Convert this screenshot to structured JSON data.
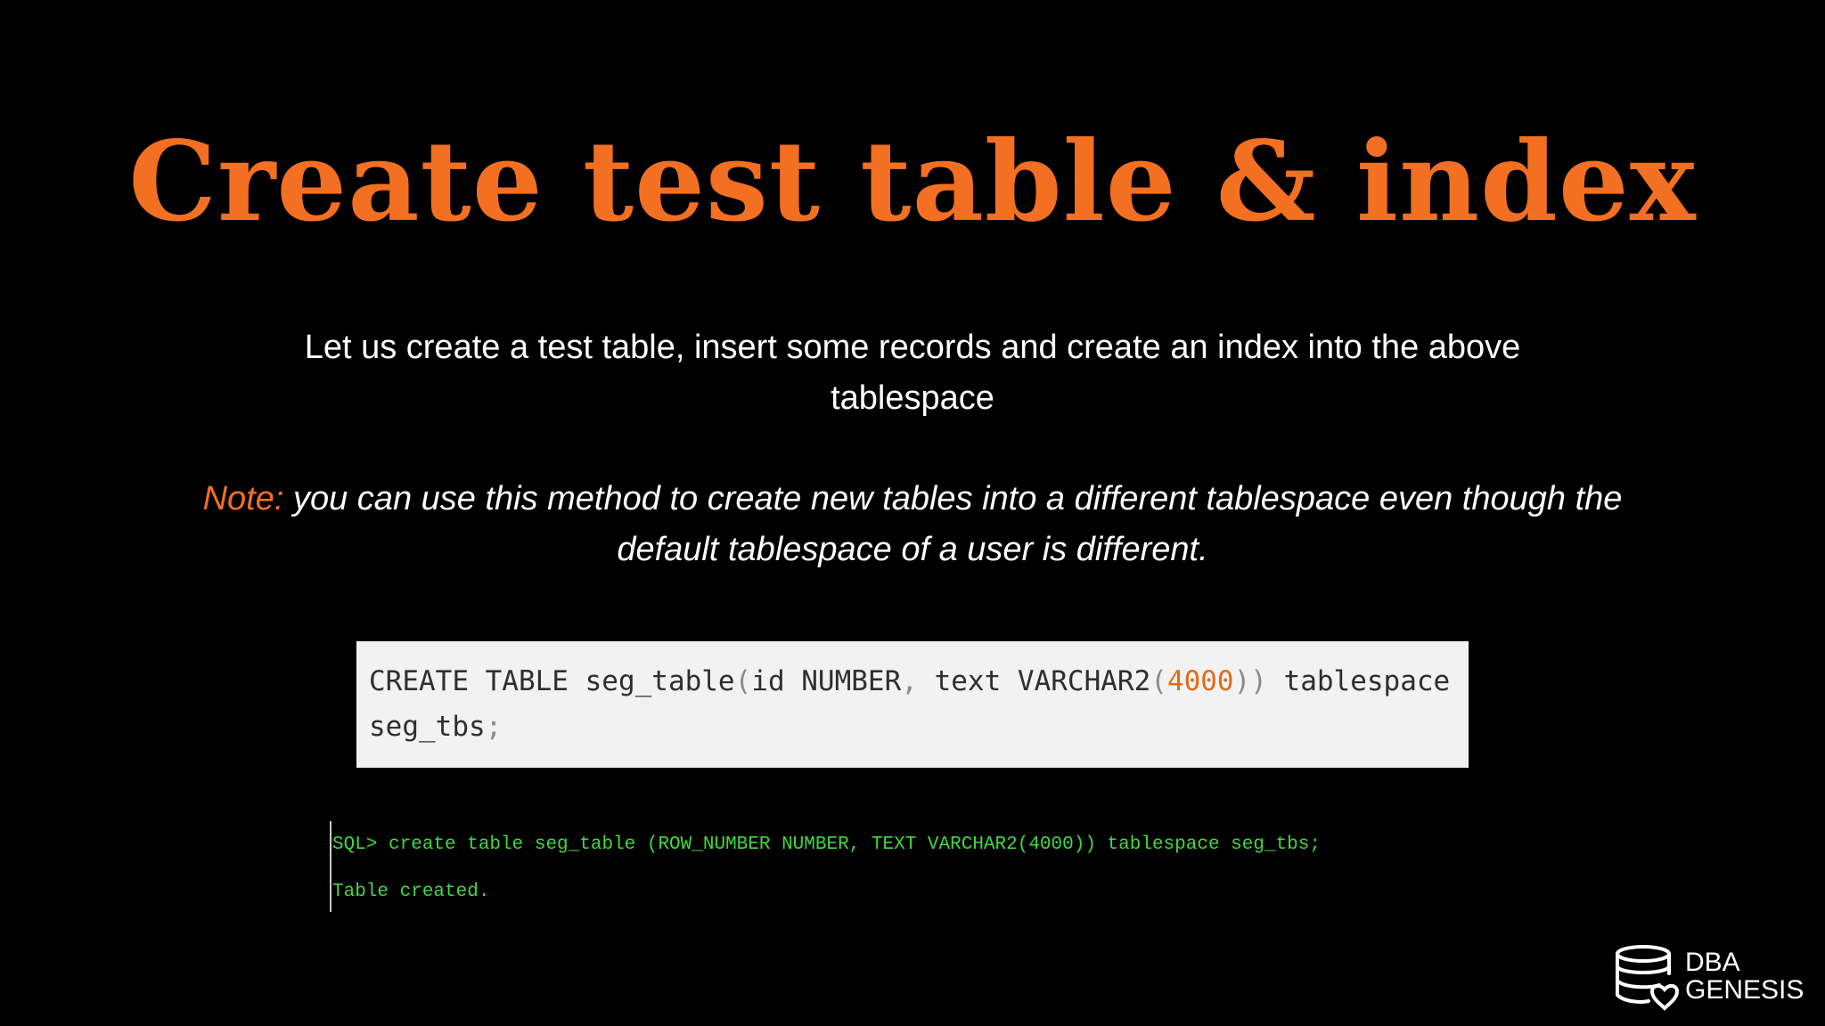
{
  "slide": {
    "title": "Create test table & index",
    "intro": "Let us create a test table, insert some records and create an index into the above tablespace",
    "note_label": "Note:",
    "note_text": " you can use this method to create new tables into a different tablespace even though the default tablespace of a user is different."
  },
  "code_snippet": {
    "part1": "CREATE TABLE seg_table",
    "paren_open": "(",
    "part2": "id NUMBER",
    "comma": ",",
    "part3": " text VARCHAR2",
    "paren_open2": "(",
    "number": "4000",
    "paren_close": "))",
    "part4": " tablespace",
    "line2": "seg_tbs",
    "semicolon": ";"
  },
  "terminal": {
    "line1": "SQL> create table seg_table (ROW_NUMBER NUMBER, TEXT VARCHAR2(4000)) tablespace seg_tbs;",
    "line2": "Table created."
  },
  "logo": {
    "line1": "DBA",
    "line2": "GENESIS"
  },
  "colors": {
    "accent": "#f36f21",
    "terminal_text": "#3fd83f",
    "background": "#000000",
    "code_background": "#f2f2f2"
  },
  "icons": {
    "logo": "database-heart-icon"
  }
}
